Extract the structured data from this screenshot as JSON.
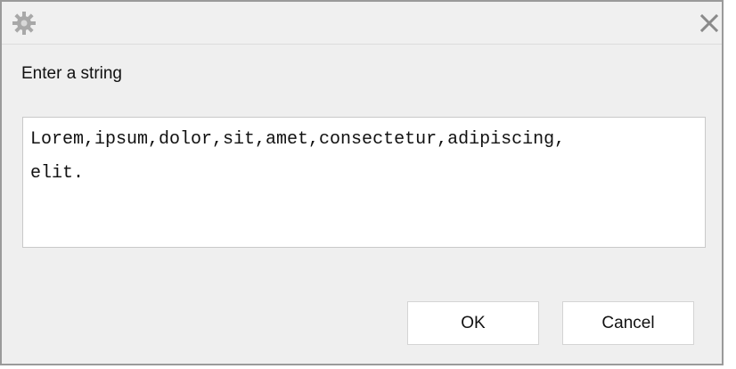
{
  "dialog": {
    "prompt": "Enter a string",
    "input_value": "Lorem,ipsum,dolor,sit,amet,consectetur,adipiscing,\nelit.",
    "ok_label": "OK",
    "cancel_label": "Cancel"
  },
  "icons": {
    "app": "gear-icon",
    "close": "close-icon"
  },
  "colors": {
    "dialog_bg": "#efefef",
    "border": "#9a9a9a",
    "icon_gray": "#9e9e9e"
  }
}
